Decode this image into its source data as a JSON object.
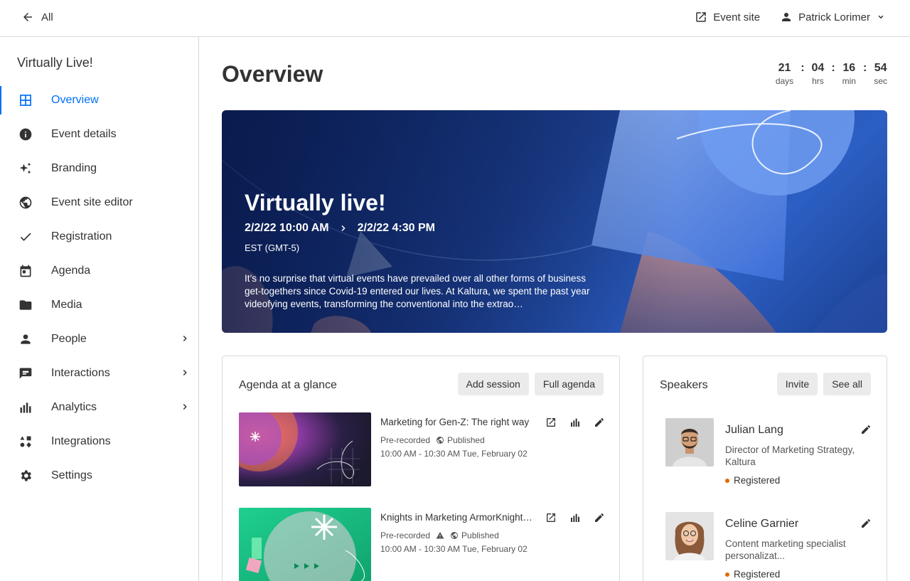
{
  "topbar": {
    "back_label": "All",
    "event_site_label": "Event site",
    "user_name": "Patrick Lorimer"
  },
  "sidebar": {
    "event_name": "Virtually Live!",
    "items": [
      {
        "label": "Overview",
        "icon": "grid-icon",
        "active": true
      },
      {
        "label": "Event details",
        "icon": "info-icon"
      },
      {
        "label": "Branding",
        "icon": "sparkles-icon"
      },
      {
        "label": "Event site editor",
        "icon": "globe-icon"
      },
      {
        "label": "Registration",
        "icon": "check-icon"
      },
      {
        "label": "Agenda",
        "icon": "calendar-icon"
      },
      {
        "label": "Media",
        "icon": "folder-icon"
      },
      {
        "label": "People",
        "icon": "person-icon",
        "expandable": true
      },
      {
        "label": "Interactions",
        "icon": "chat-icon",
        "expandable": true
      },
      {
        "label": "Analytics",
        "icon": "bar-chart-icon",
        "expandable": true
      },
      {
        "label": "Integrations",
        "icon": "shapes-icon"
      },
      {
        "label": "Settings",
        "icon": "gear-icon"
      }
    ]
  },
  "main": {
    "title": "Overview",
    "countdown": {
      "days": "21",
      "days_label": "days",
      "hrs": "04",
      "hrs_label": "hrs",
      "min": "16",
      "min_label": "min",
      "sec": "54",
      "sec_label": "sec"
    },
    "hero": {
      "title": "Virtually live!",
      "start": "2/2/22 10:00 AM",
      "end": "2/2/22 4:30 PM",
      "timezone": "EST (GMT-5)",
      "description": "It’s no surprise that virtual events have prevailed over all other forms of business get-togethers since Covid-19 entered our lives. At Kaltura, we spent the past year videofying events, transforming the conventional into the extrao…"
    },
    "agenda": {
      "title": "Agenda at a glance",
      "add_label": "Add session",
      "full_label": "Full agenda",
      "sessions": [
        {
          "title": "Marketing for Gen-Z: The right way",
          "type": "Pre-recorded",
          "status": "Published",
          "time": "10:00 AM - 10:30 AM  Tue, February 02"
        },
        {
          "title": "Knights in Marketing ArmorKnights in Marketing Armor",
          "type": "Pre-recorded",
          "status": "Published",
          "time": "10:00 AM - 10:30 AM  Tue, February 02"
        }
      ]
    },
    "speakers": {
      "title": "Speakers",
      "invite_label": "Invite",
      "see_all_label": "See all",
      "list": [
        {
          "name": "Julian Lang",
          "role": "Director of Marketing Strategy, Kaltura",
          "status": "Registered"
        },
        {
          "name": "Celine Garnier",
          "role": "Content marketing specialist personalizat...",
          "status": "Registered"
        }
      ]
    },
    "colors": {
      "accent": "#006efa",
      "status_dot": "#e06b00"
    }
  }
}
